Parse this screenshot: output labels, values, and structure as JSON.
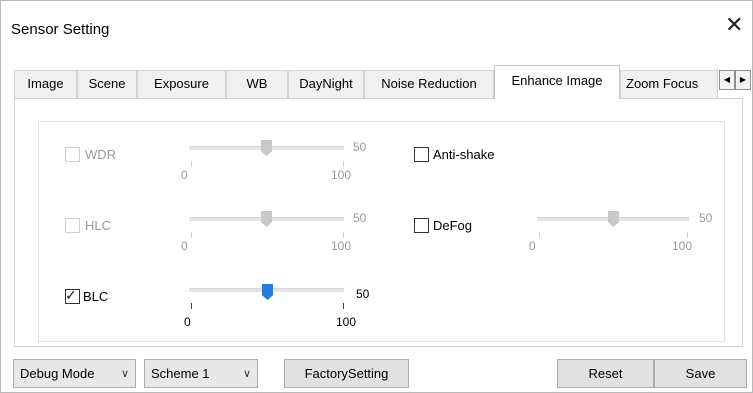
{
  "window": {
    "title": "Sensor Setting",
    "close_glyph": "✕"
  },
  "tabs": [
    {
      "label": "Image"
    },
    {
      "label": "Scene"
    },
    {
      "label": "Exposure"
    },
    {
      "label": "WB"
    },
    {
      "label": "DayNight"
    },
    {
      "label": "Noise Reduction"
    },
    {
      "label": "Enhance Image",
      "active": true
    },
    {
      "label": "Zoom Focus"
    }
  ],
  "tab_scroll": {
    "left": "◀",
    "right": "▶"
  },
  "settings": {
    "wdr": {
      "label": "WDR",
      "checked": false,
      "enabled": false,
      "value": "50",
      "min": "0",
      "max": "100",
      "level": 0.5
    },
    "hlc": {
      "label": "HLC",
      "checked": false,
      "enabled": false,
      "value": "50",
      "min": "0",
      "max": "100",
      "level": 0.5
    },
    "blc": {
      "label": "BLC",
      "checked": true,
      "enabled": true,
      "value": "50",
      "min": "0",
      "max": "100",
      "level": 0.5
    },
    "anti_shake": {
      "label": "Anti-shake",
      "checked": false,
      "enabled": true
    },
    "defog": {
      "label": "DeFog",
      "checked": false,
      "enabled": true,
      "value": "50",
      "min": "0",
      "max": "100",
      "level": 0.5,
      "slider_enabled": false
    }
  },
  "check_mark": "✓",
  "bottom": {
    "debug_mode": "Debug Mode",
    "scheme": "Scheme 1",
    "factory_setting": "FactorySetting",
    "reset": "Reset",
    "save": "Save",
    "combo_arrow": "∨"
  },
  "colors": {
    "accent": "#2a7ad7"
  }
}
